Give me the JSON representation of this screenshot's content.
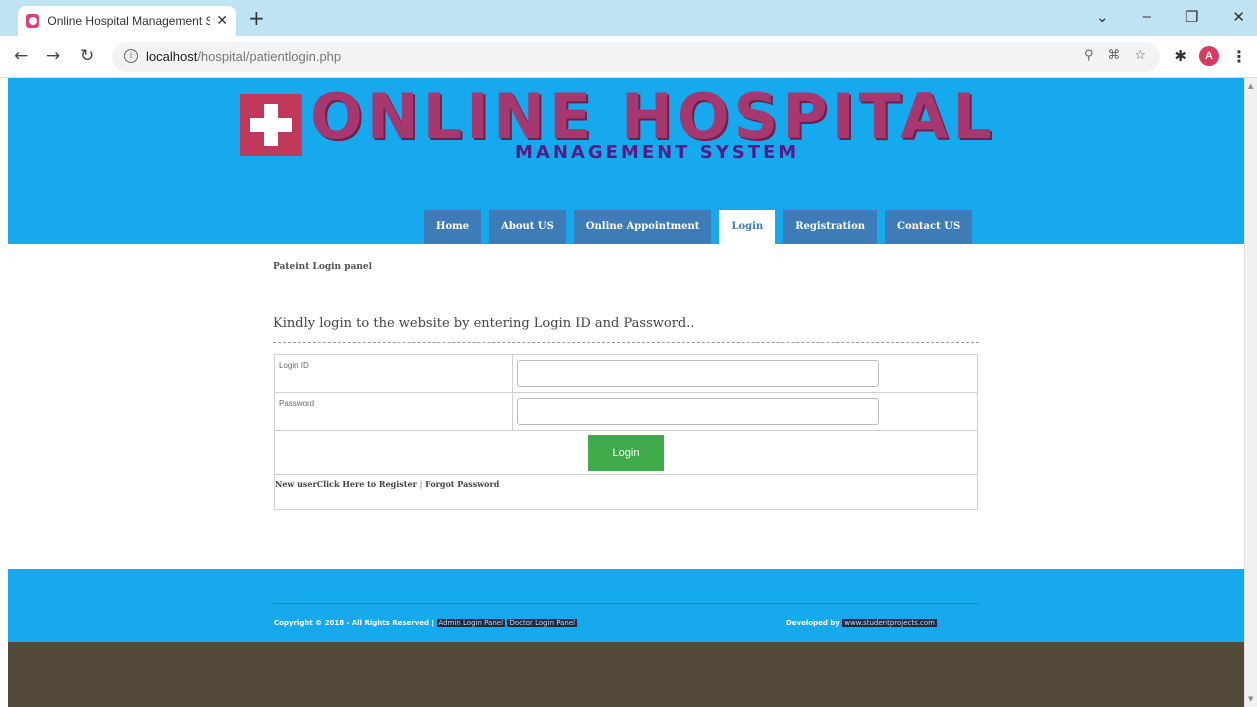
{
  "browser": {
    "tab_title": "Online Hospital Management Sy",
    "url_host": "localhost",
    "url_path": "/hospital/patientlogin.php",
    "avatar_letter": "A"
  },
  "header": {
    "title": "ONLINE HOSPITAL",
    "subtitle": "MANAGEMENT SYSTEM",
    "colors": {
      "header_bg": "#16a9ee",
      "menu_bg": "#3e7cb8",
      "title": "#a6386f"
    }
  },
  "menu": {
    "items": [
      {
        "label": "Home"
      },
      {
        "label": "About US"
      },
      {
        "label": "Online Appointment"
      },
      {
        "label": "Login",
        "active": true
      },
      {
        "label": "Registration"
      },
      {
        "label": "Contact US"
      }
    ]
  },
  "page": {
    "panel_title": "Pateint Login panel",
    "intro": "Kindly login to the website by entering Login ID and Password.."
  },
  "form": {
    "login_id_label": "Login ID",
    "password_label": "Password",
    "login_id_value": "",
    "password_value": "",
    "submit_label": "Login",
    "new_user": "New user",
    "register_link": "Click Here to Register",
    "separator": "|",
    "forgot_link": "Forgot Password",
    "button_color": "#3faa4a"
  },
  "footer": {
    "copyright": "Copyright © 2018 - All Rights Reserved |",
    "admin_link": "Admin Login Panel",
    "doctor_link": "Doctor Login Panel",
    "developed_by": "Developed by",
    "developer_link": "www.studentprojects.com"
  }
}
